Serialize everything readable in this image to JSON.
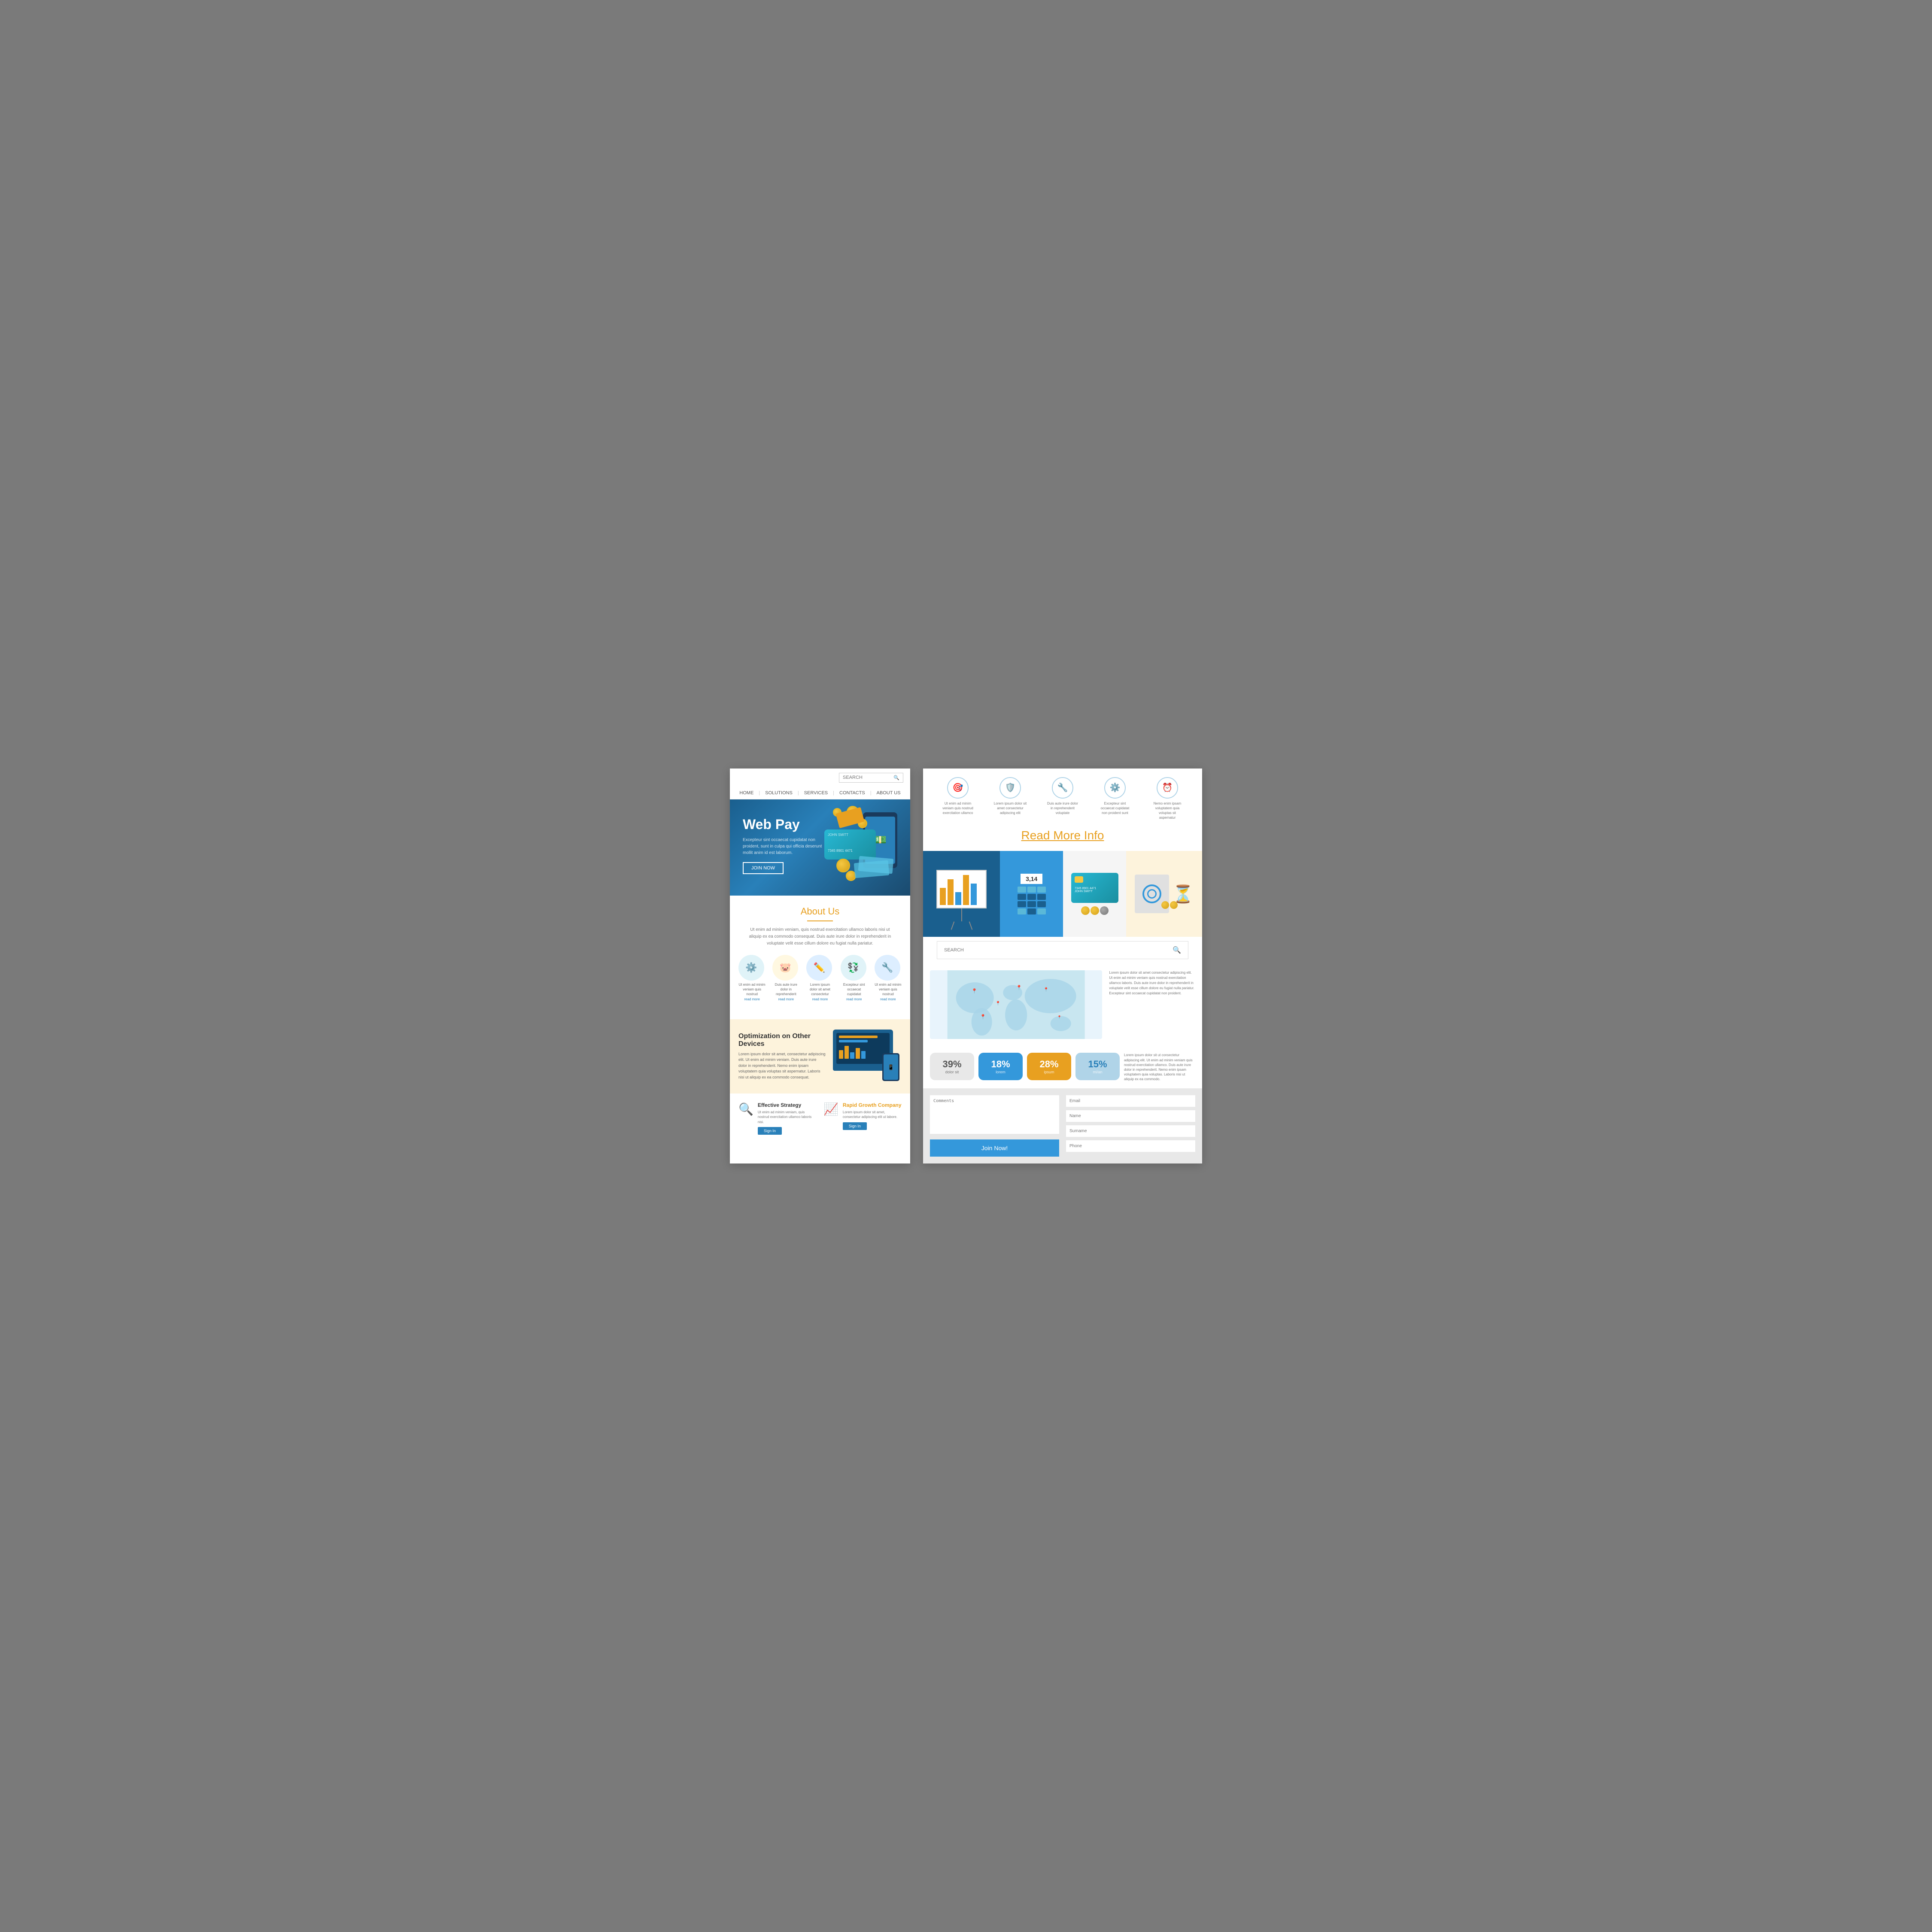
{
  "left": {
    "header": {
      "search_placeholder": "SEARCH"
    },
    "nav": {
      "items": [
        "HOME",
        "SOLUTIONS",
        "SERVICES",
        "CONTACTS",
        "ABOUT US"
      ]
    },
    "hero": {
      "title": "Web Pay",
      "desc": "Excepteur sint occaecat cupidatat non proident, sunt in culpa qui officia deserunt mollit anim id est laborum.",
      "btn_label": "JOIN NOW"
    },
    "about": {
      "title": "About Us",
      "text": "Ut enim ad minim veniam, quis nostrud exercitation ullamco laboris nisi ut aliquip ex ea commodo consequat. Duis aute irure dolor in reprehenderit in voluptate velit esse cillum dolore eu fugiat nulla pariatur.",
      "icons": [
        {
          "symbol": "⚙️",
          "text": "Ut enim ad minim veniam, quis nostrud exercitation ullamco"
        },
        {
          "symbol": "🐷",
          "text": "Duis aute irure dolor in reprehenderit in voluptate"
        },
        {
          "symbol": "✏️",
          "text": "Lorem ipsum dolor sit amet, consectetur adipiscing"
        },
        {
          "symbol": "💰",
          "text": "Excepteur sint occaecat cupidatat non culpa"
        },
        {
          "symbol": "🔧",
          "text": "Ut enim ad minim veniam quis nostrud"
        }
      ]
    },
    "optimization": {
      "title": "Optimization on Other Devices",
      "desc": "Lorem ipsum dolor sit amet, consectetur adipiscing elit. Ut enim ad minim veniam. Duis aute irure dolor in reprehenderit. Nemo enim ipsam voluptatem quia voluptas sit aspernatur. Laboris nisi ut aliquip ex ea commodo consequat."
    },
    "strategy": {
      "left": {
        "title": "Effective Strategy",
        "text": "Ut enim ad minim veniam, quis nostrud exercitation ullamco laboris nisi.",
        "btn": "Sign In"
      },
      "right": {
        "title": "Rapid Growth Company",
        "text": "Lorem ipsum dolor sit amet, consectetur adipiscing elit ut labore.",
        "btn": "Sign In"
      }
    }
  },
  "right": {
    "icons": [
      {
        "symbol": "🎯",
        "text": "Ut enim ad minim veniam quis nostrud exercitation ullamco"
      },
      {
        "symbol": "🛡️",
        "text": "Lorem ipsum dolor sit amet consectetur adipiscing elit"
      },
      {
        "symbol": "🔧",
        "text": "Duis aute irure dolor in reprehenderit voluptate"
      },
      {
        "symbol": "⚙️",
        "text": "Excepteur sint occaecat cupidatat non proident sunt"
      },
      {
        "symbol": "⏰",
        "text": "Nemo enim ipsam voluptatem quia voluptas sit aspernatur"
      }
    ],
    "read_more": "Read More Info",
    "search_placeholder": "SEARCH",
    "stats": [
      {
        "percent": "39%",
        "label": "dolor sit",
        "style": "gray"
      },
      {
        "percent": "18%",
        "label": "lorem",
        "style": "blue"
      },
      {
        "percent": "28%",
        "label": "ipsum",
        "style": "gold"
      },
      {
        "percent": "15%",
        "label": "mi/an",
        "style": "light-blue"
      }
    ],
    "stats_desc": "Lorem ipsum dolor sit ut consectetur adipiscing elit. Ut enim ad minim veniam quis nostrud exercitation ullamco. Duis aute irure dolor in reprehenderit. Nemo enim ipsam voluptatem quia voluptas. Laboris nisi ut aliquip ex ea commodo.",
    "map": {
      "text": "Lorem ipsum dolor sit amet consectetur adipiscing elit. Ut enim ad minim veniam quis nostrud exercitation ullamco laboris. Duis aute irure dolor in reprehenderit in voluptate velit esse cillum dolore eu fugiat nulla pariatur. Excepteur sint occaecat cupidatat non proident."
    },
    "contact": {
      "comments_placeholder": "Comments",
      "email_placeholder": "Email",
      "name_placeholder": "Name",
      "surname_placeholder": "Surname",
      "phone_placeholder": "Phone",
      "join_btn": "Join Now!"
    }
  }
}
